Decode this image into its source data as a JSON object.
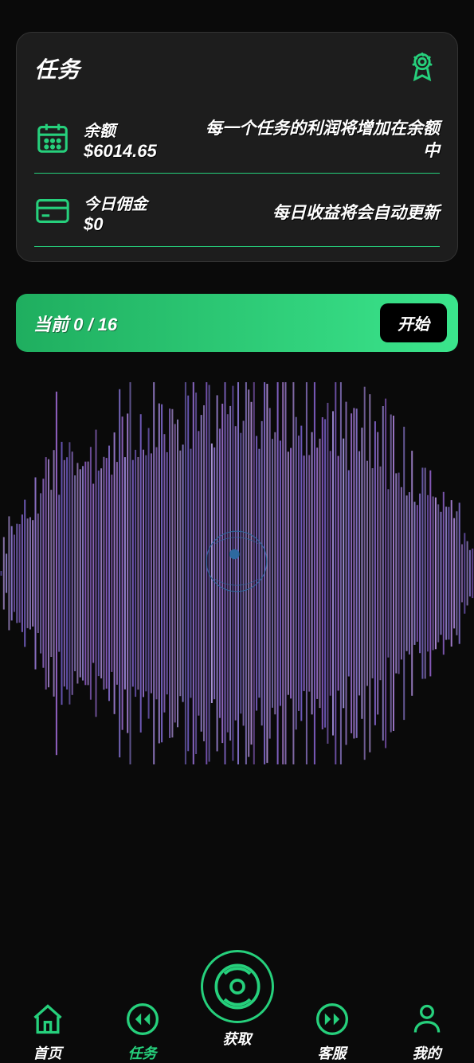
{
  "card": {
    "title": "任务",
    "rows": [
      {
        "label": "余额",
        "value": "$6014.65",
        "desc": "每一个任务的利润将增加在余额中",
        "icon": "calendar-icon"
      },
      {
        "label": "今日佣金",
        "value": "$0",
        "desc": "每日收益将会自动更新",
        "icon": "card-icon"
      }
    ]
  },
  "progress": {
    "label": "当前 0 / 16",
    "button": "开始"
  },
  "nav": {
    "items": [
      {
        "label": "首页",
        "icon": "home-icon",
        "active": false
      },
      {
        "label": "任务",
        "icon": "rewind-icon",
        "active": true
      },
      {
        "label": "获取",
        "icon": "disc-icon",
        "active": false,
        "center": true
      },
      {
        "label": "客服",
        "icon": "forward-icon",
        "active": false
      },
      {
        "label": "我的",
        "icon": "user-icon",
        "active": false
      }
    ]
  },
  "colors": {
    "accent": "#26d07c",
    "wave": "#8378d9"
  }
}
